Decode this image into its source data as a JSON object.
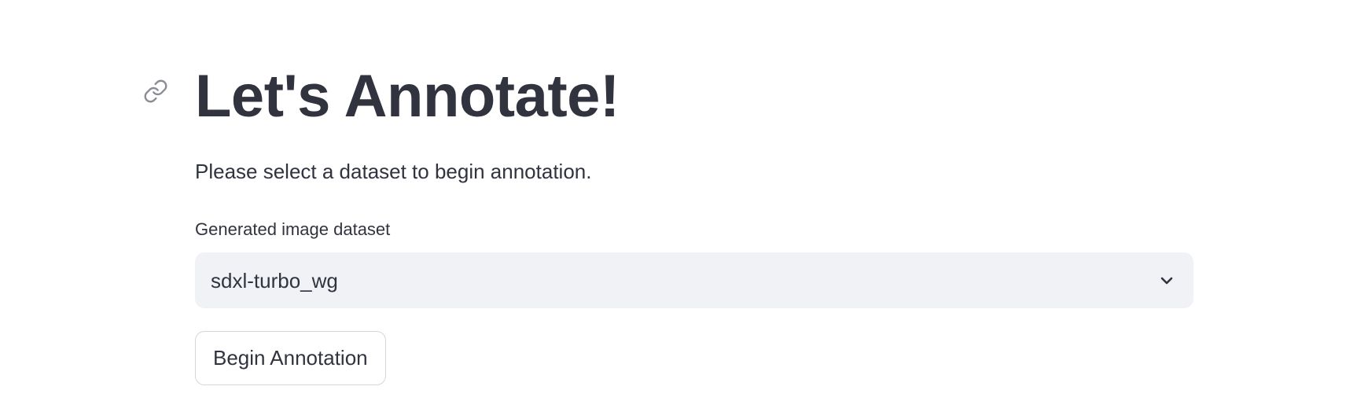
{
  "header": {
    "title": "Let's Annotate!",
    "anchor_icon": "link-icon"
  },
  "main": {
    "instruction": "Please select a dataset to begin annotation.",
    "dataset_select": {
      "label": "Generated image dataset",
      "selected_value": "sdxl-turbo_wg",
      "chevron_icon": "chevron-down-icon"
    },
    "begin_button_label": "Begin Annotation"
  },
  "colors": {
    "text": "#31333f",
    "select_background": "#f0f2f6",
    "button_border": "#d6d6d9",
    "anchor_icon": "#8a8d96"
  }
}
